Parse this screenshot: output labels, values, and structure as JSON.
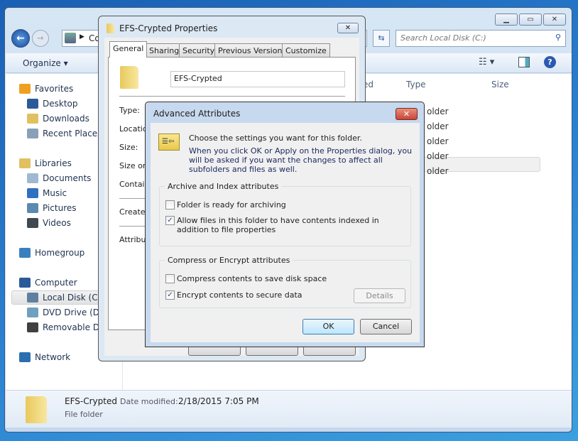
{
  "explorer": {
    "address_crumb": "Co",
    "search_placeholder": "Search Local Disk (C:)",
    "organize": "Organize",
    "columns": [
      "ed",
      "Type",
      "Size"
    ],
    "rows": [
      "older",
      "older",
      "older",
      "older",
      "older"
    ],
    "sidebar": [
      {
        "label": "Favorites",
        "icon": "star-icon",
        "color": "#f0a020"
      },
      {
        "label": "Desktop",
        "icon": "desktop-icon",
        "color": "#2a5a9a"
      },
      {
        "label": "Downloads",
        "icon": "downloads-folder-icon",
        "color": "#e0c060"
      },
      {
        "label": "Recent Places",
        "icon": "recent-places-icon",
        "color": "#8aa0b8"
      },
      {
        "label": "Libraries",
        "icon": "libraries-icon",
        "color": "#e0c060"
      },
      {
        "label": "Documents",
        "icon": "documents-icon",
        "color": "#a0b8d0"
      },
      {
        "label": "Music",
        "icon": "music-icon",
        "color": "#3070c0"
      },
      {
        "label": "Pictures",
        "icon": "pictures-icon",
        "color": "#5a8ab0"
      },
      {
        "label": "Videos",
        "icon": "videos-icon",
        "color": "#404850"
      },
      {
        "label": "Homegroup",
        "icon": "homegroup-icon",
        "color": "#3a80c0"
      },
      {
        "label": "Computer",
        "icon": "computer-icon",
        "color": "#2a5a9a"
      },
      {
        "label": "Local Disk (C:)",
        "icon": "local-disk-icon",
        "color": "#6080a0",
        "selected": true
      },
      {
        "label": "DVD Drive (D:)",
        "icon": "dvd-drive-icon",
        "color": "#70a0c0"
      },
      {
        "label": "Removable Di",
        "icon": "removable-disk-icon",
        "color": "#404040"
      },
      {
        "label": "Network",
        "icon": "network-icon",
        "color": "#2a70b0"
      }
    ],
    "details": {
      "name": "EFS-Crypted",
      "date_label": "Date modified:",
      "date_value": "2/18/2015 7:05 PM",
      "type": "File folder"
    }
  },
  "properties": {
    "title": "EFS-Crypted Properties",
    "tabs": [
      "General",
      "Sharing",
      "Security",
      "Previous Versions",
      "Customize"
    ],
    "active_tab": "General",
    "name_value": "EFS-Crypted",
    "labels": [
      "Type:",
      "Location",
      "Size:",
      "Size on",
      "Contains",
      "Created",
      "Attribute"
    ]
  },
  "advanced": {
    "title": "Advanced Attributes",
    "intro": "Choose the settings you want for this folder.",
    "note": "When you click OK or Apply on the Properties dialog, you will be asked if you want the changes to affect all subfolders and files as well.",
    "group1": {
      "title": "Archive and Index attributes",
      "options": [
        {
          "label": "Folder is ready for archiving",
          "checked": false
        },
        {
          "label": "Allow files in this folder to have contents indexed in addition to file properties",
          "checked": true
        }
      ]
    },
    "group2": {
      "title": "Compress or Encrypt attributes",
      "options": [
        {
          "label": "Compress contents to save disk space",
          "checked": false
        },
        {
          "label": "Encrypt contents to secure data",
          "checked": true
        }
      ]
    },
    "details_button": "Details",
    "ok": "OK",
    "cancel": "Cancel",
    "accent": "#c8463a"
  }
}
